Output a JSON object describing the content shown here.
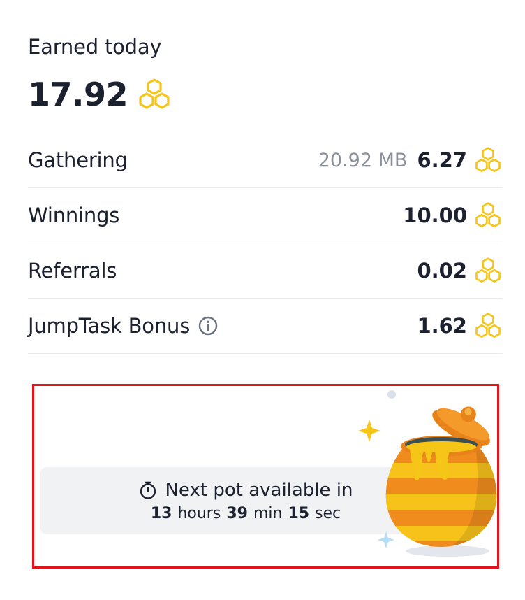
{
  "summary": {
    "label": "Earned today",
    "total": "17.92",
    "currency_icon": "honeycomb-icon"
  },
  "breakdown": [
    {
      "label": "Gathering",
      "data": "20.92 MB",
      "value": "6.27",
      "info": false
    },
    {
      "label": "Winnings",
      "data": "",
      "value": "10.00",
      "info": false
    },
    {
      "label": "Referrals",
      "data": "",
      "value": "0.02",
      "info": false
    },
    {
      "label": "JumpTask Bonus",
      "data": "",
      "value": "1.62",
      "info": true
    }
  ],
  "pot": {
    "title": "Next pot available in",
    "hours": "13",
    "hours_unit": "hours",
    "minutes": "39",
    "minutes_unit": "min",
    "seconds": "15",
    "seconds_unit": "sec"
  },
  "colors": {
    "honeycomb": "#F5C518",
    "highlight_border": "#E1141C",
    "countdown_bg": "#F1F2F4",
    "pot_orange": "#F08C1E",
    "pot_yellow": "#F7C21A"
  }
}
